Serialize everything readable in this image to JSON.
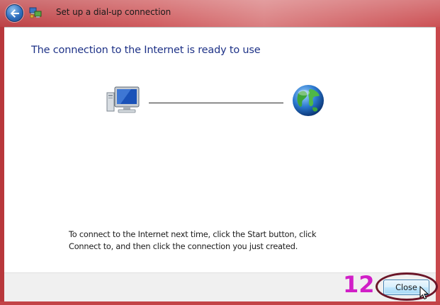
{
  "window": {
    "title": "Set up a dial-up connection"
  },
  "main": {
    "heading": "The connection to the Internet is ready to use",
    "instructions_line1": "To connect to the Internet next time, click the Start button, click",
    "instructions_line2": "Connect to, and then click the connection you just created."
  },
  "diagram": {
    "left_icon": "computer-icon",
    "right_icon": "globe-icon"
  },
  "footer": {
    "step_annotation": "12",
    "close_label": "Close"
  },
  "colors": {
    "heading": "#1e3287",
    "window_frame": "#c9474b",
    "annotation": "#d11fc7",
    "highlight_ring": "#6b1628"
  }
}
